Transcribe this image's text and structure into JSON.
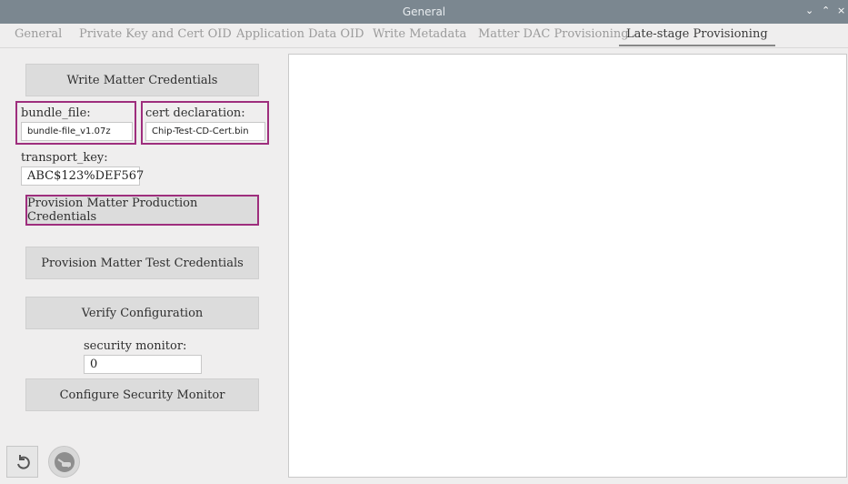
{
  "window": {
    "title": "General",
    "controls": [
      "⌄",
      "⌃",
      "×"
    ]
  },
  "tabs": [
    {
      "label": "General"
    },
    {
      "label": "Private Key and Cert OID"
    },
    {
      "label": "Application Data OID"
    },
    {
      "label": "Write Metadata"
    },
    {
      "label": "Matter DAC Provisioning"
    },
    {
      "label": "Late-stage Provisioning"
    }
  ],
  "active_tab": "Late-stage Provisioning",
  "panel": {
    "write_credentials_label": "Write Matter Credentials",
    "bundle_file": {
      "label": "bundle_file:",
      "value": "bundle-file_v1.07z"
    },
    "cert_declaration": {
      "label": "cert declaration:",
      "value": "Chip-Test-CD-Cert.bin"
    },
    "transport_key": {
      "label": "transport_key:",
      "value": "ABC$123%DEF567"
    },
    "provision_production_label": "Provision Matter Production Credentials",
    "provision_test_label": "Provision Matter Test Credentials",
    "verify_label": "Verify Configuration",
    "security_monitor": {
      "label": "security monitor:",
      "value": "0"
    },
    "configure_security_label": "Configure Security Monitor"
  },
  "footer": {
    "icons": [
      "undo-icon",
      "toggle-icon"
    ]
  },
  "colors": {
    "highlight": "#9e2e7d",
    "titlebar": "#7b8790",
    "button": "#dcdcdc"
  }
}
